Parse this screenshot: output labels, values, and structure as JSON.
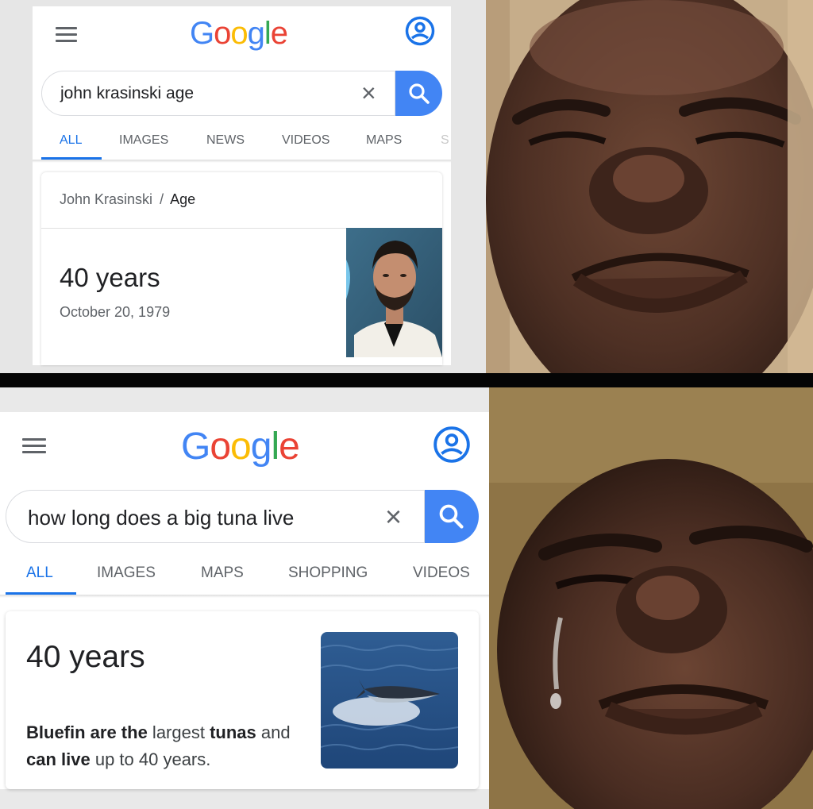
{
  "top_panel": {
    "search": {
      "query": "john krasinski age",
      "clear_label": "×"
    },
    "tabs": [
      {
        "label": "ALL"
      },
      {
        "label": "IMAGES"
      },
      {
        "label": "NEWS"
      },
      {
        "label": "VIDEOS"
      },
      {
        "label": "MAPS"
      },
      {
        "label": "S"
      }
    ],
    "breadcrumb": {
      "entity": "John Krasinski",
      "separator": "/",
      "attribute": "Age"
    },
    "answer": {
      "value": "40 years",
      "date": "October 20, 1979"
    }
  },
  "bottom_panel": {
    "search": {
      "query": "how long does a big tuna live",
      "clear_label": "×"
    },
    "tabs": [
      {
        "label": "ALL"
      },
      {
        "label": "IMAGES"
      },
      {
        "label": "MAPS"
      },
      {
        "label": "SHOPPING"
      },
      {
        "label": "VIDEOS"
      }
    ],
    "answer": {
      "value": "40 years",
      "snippet_parts": [
        "Bluefin are the",
        " largest ",
        "tunas",
        " and",
        "can live",
        " up to 40 years."
      ]
    }
  },
  "logo": {
    "letters": [
      "G",
      "o",
      "o",
      "g",
      "l",
      "e"
    ]
  },
  "icons": {
    "menu": "hamburger-menu-icon",
    "account": "account-circle-icon",
    "search": "search-magnifier-icon",
    "clear": "close-x-icon"
  },
  "colors": {
    "google_blue": "#4285f4",
    "google_red": "#ea4335",
    "google_yellow": "#fbbc05",
    "google_green": "#34a853",
    "tab_active": "#1a73e8",
    "text_secondary": "#5f6368"
  }
}
